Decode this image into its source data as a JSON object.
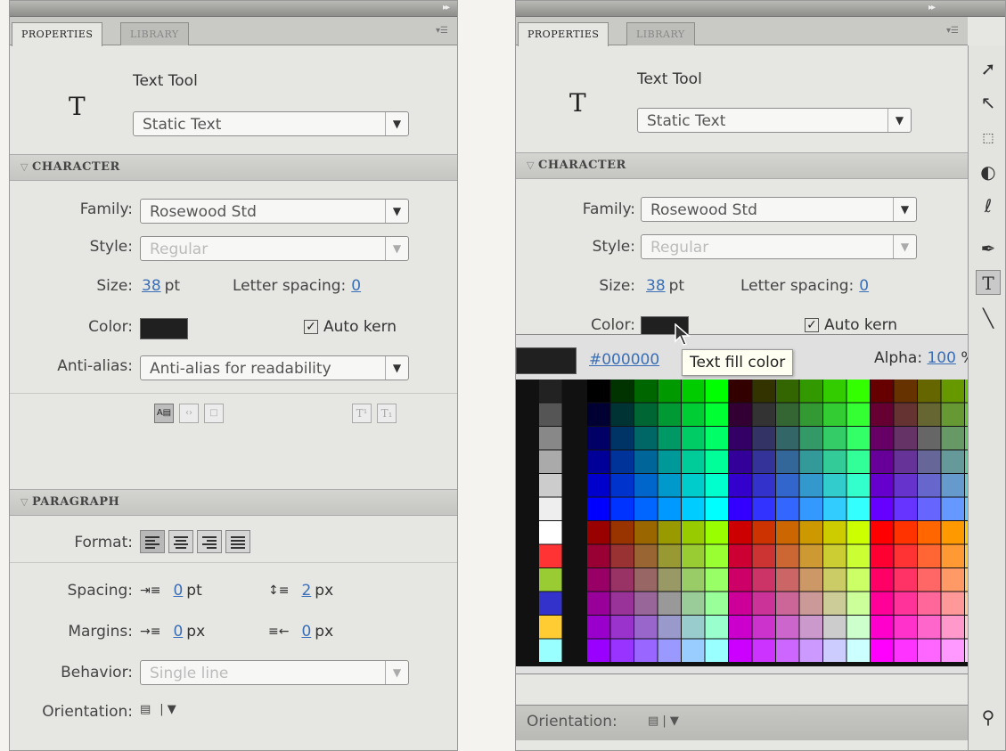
{
  "left": {
    "tabs": [
      {
        "label": "PROPERTIES"
      },
      {
        "label": "LIBRARY"
      }
    ],
    "tool_icon": "T",
    "tool_name": "Text Tool",
    "text_type": "Static Text",
    "character": {
      "header": "CHARACTER",
      "family_label": "Family:",
      "family_value": "Rosewood Std",
      "style_label": "Style:",
      "style_value": "Regular",
      "size_label": "Size:",
      "size_value": "38",
      "size_unit": "pt",
      "letter_spacing_label": "Letter spacing:",
      "letter_spacing_value": "0",
      "color_label": "Color:",
      "color_value": "#202020",
      "auto_kern_label": "Auto kern",
      "auto_kern_checked": true,
      "anti_alias_label": "Anti-alias:",
      "anti_alias_value": "Anti-alias for readability",
      "superscript_icon": "T¹",
      "subscript_icon": "T₁"
    },
    "paragraph": {
      "header": "PARAGRAPH",
      "format_label": "Format:",
      "spacing_label": "Spacing:",
      "spacing_indent_value": "0",
      "spacing_indent_unit": "pt",
      "spacing_line_value": "2",
      "spacing_line_unit": "px",
      "margins_label": "Margins:",
      "margin_left_value": "0",
      "margin_left_unit": "px",
      "margin_right_value": "0",
      "margin_right_unit": "px",
      "behavior_label": "Behavior:",
      "behavior_value": "Single line",
      "orientation_label": "Orientation:"
    }
  },
  "right": {
    "tabs": [
      {
        "label": "PROPERTIES"
      },
      {
        "label": "LIBRARY"
      }
    ],
    "tool_icon": "T",
    "tool_name": "Text Tool",
    "text_type": "Static Text",
    "character": {
      "header": "CHARACTER",
      "family_label": "Family:",
      "family_value": "Rosewood Std",
      "style_label": "Style:",
      "style_value": "Regular",
      "size_label": "Size:",
      "size_value": "38",
      "size_unit": "pt",
      "letter_spacing_label": "Letter spacing:",
      "letter_spacing_value": "0",
      "color_label": "Color:",
      "auto_kern_label": "Auto kern"
    },
    "color_picker": {
      "hex_value": "#000000",
      "tooltip": "Text fill color",
      "alpha_label": "Alpha:",
      "alpha_value": "100",
      "alpha_unit": "%"
    },
    "orientation_label": "Orientation:",
    "tools": [
      "selection-tool",
      "subselection-tool",
      "free-transform-tool",
      "3d-rotation-tool",
      "lasso-tool",
      "pen-tool",
      "text-tool",
      "line-tool"
    ]
  },
  "icons": {
    "panel_menu": "panel-menu-icon",
    "collapse": "collapse-arrows-icon",
    "section_toggle": "triangle-down-icon"
  }
}
